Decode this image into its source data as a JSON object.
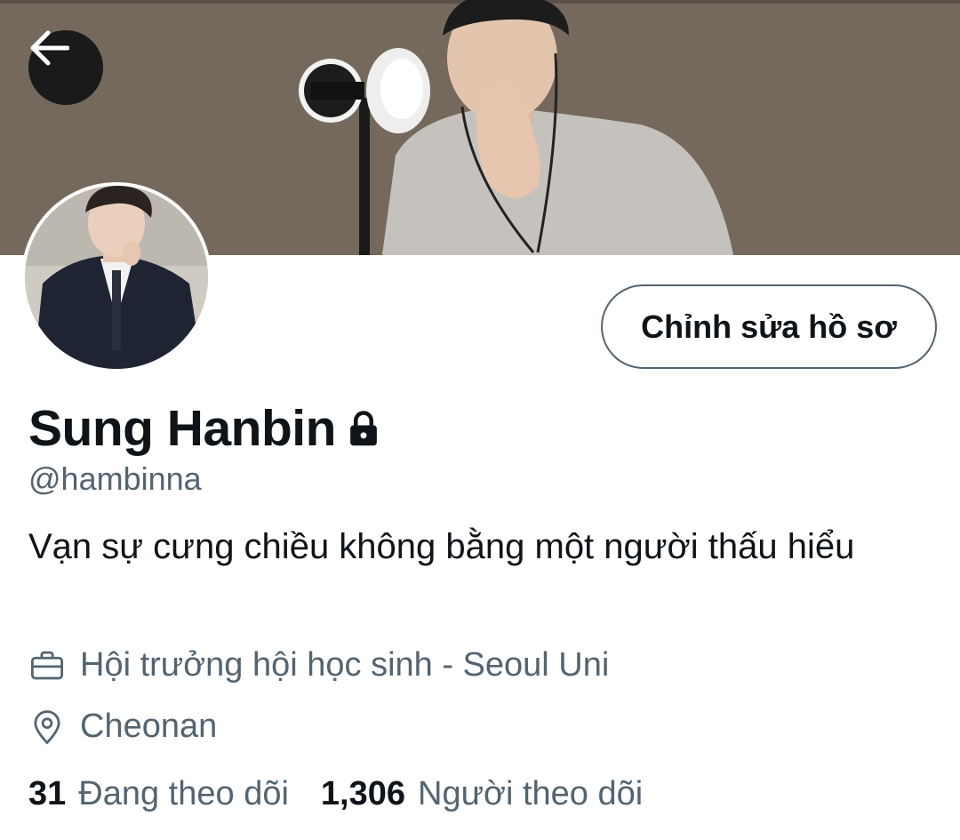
{
  "profile": {
    "name": "Sung Hanbin",
    "handle": "@hambinna",
    "bio": "Vạn sự cưng chiều không bằng một người thấu hiểu",
    "job": "Hội trưởng hội học sinh - Seoul Uni",
    "location": "Cheonan"
  },
  "buttons": {
    "edit_profile": "Chỉnh sửa hồ sơ"
  },
  "stats": {
    "following_count": "31",
    "following_label": "Đang theo dõi",
    "followers_count": "1,306",
    "followers_label": "Người theo dõi"
  },
  "icons": {
    "back": "arrow-left-icon",
    "lock": "lock-icon",
    "job": "briefcase-icon",
    "location": "location-pin-icon"
  },
  "colors": {
    "text_primary": "#0f1419",
    "text_secondary": "#536471",
    "border": "#536471"
  }
}
